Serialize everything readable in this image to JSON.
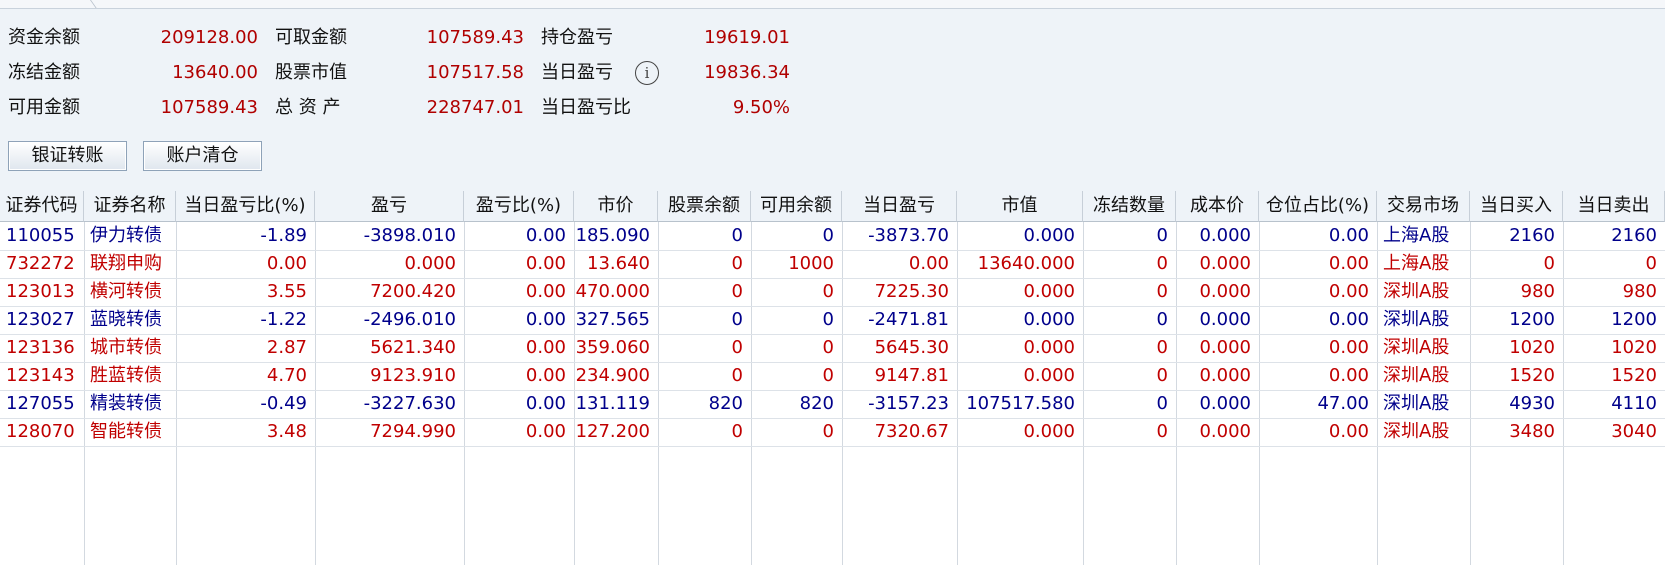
{
  "summary": [
    {
      "label": "资金余额",
      "value": "209128.00"
    },
    {
      "label": "冻结金额",
      "value": "13640.00"
    },
    {
      "label": "可用金额",
      "value": "107589.43"
    },
    {
      "label": "可取金额",
      "value": "107589.43"
    },
    {
      "label": "股票市值",
      "value": "107517.58"
    },
    {
      "label": "总 资 产",
      "value": "228747.01"
    },
    {
      "label": "持仓盈亏",
      "value": "19619.01"
    },
    {
      "label": "当日盈亏",
      "value": "19836.34"
    },
    {
      "label": "当日盈亏比",
      "value": "9.50%"
    }
  ],
  "info_icon": "i",
  "buttons": {
    "transfer": "银证转账",
    "clear": "账户清仓"
  },
  "columns": [
    "证券代码",
    "证券名称",
    "当日盈亏比(%)",
    "盈亏",
    "盈亏比(%)",
    "市价",
    "股票余额",
    "可用余额",
    "当日盈亏",
    "市值",
    "冻结数量",
    "成本价",
    "仓位占比(%)",
    "交易市场",
    "当日买入",
    "当日卖出"
  ],
  "rows": [
    {
      "color": "blue",
      "cells": [
        "110055",
        "伊力转债",
        "-1.89",
        "-3898.010",
        "0.00",
        "185.090",
        "0",
        "0",
        "-3873.70",
        "0.000",
        "0",
        "0.000",
        "0.00",
        "上海A股",
        "2160",
        "2160"
      ]
    },
    {
      "color": "red",
      "cells": [
        "732272",
        "联翔申购",
        "0.00",
        "0.000",
        "0.00",
        "13.640",
        "0",
        "1000",
        "0.00",
        "13640.000",
        "0",
        "0.000",
        "0.00",
        "上海A股",
        "0",
        "0"
      ]
    },
    {
      "color": "red",
      "cells": [
        "123013",
        "横河转债",
        "3.55",
        "7200.420",
        "0.00",
        "470.000",
        "0",
        "0",
        "7225.30",
        "0.000",
        "0",
        "0.000",
        "0.00",
        "深圳A股",
        "980",
        "980"
      ]
    },
    {
      "color": "blue",
      "cells": [
        "123027",
        "蓝晓转债",
        "-1.22",
        "-2496.010",
        "0.00",
        "327.565",
        "0",
        "0",
        "-2471.81",
        "0.000",
        "0",
        "0.000",
        "0.00",
        "深圳A股",
        "1200",
        "1200"
      ]
    },
    {
      "color": "red",
      "cells": [
        "123136",
        "城市转债",
        "2.87",
        "5621.340",
        "0.00",
        "359.060",
        "0",
        "0",
        "5645.30",
        "0.000",
        "0",
        "0.000",
        "0.00",
        "深圳A股",
        "1020",
        "1020"
      ]
    },
    {
      "color": "red",
      "cells": [
        "123143",
        "胜蓝转债",
        "4.70",
        "9123.910",
        "0.00",
        "234.900",
        "0",
        "0",
        "9147.81",
        "0.000",
        "0",
        "0.000",
        "0.00",
        "深圳A股",
        "1520",
        "1520"
      ]
    },
    {
      "color": "blue",
      "cells": [
        "127055",
        "精装转债",
        "-0.49",
        "-3227.630",
        "0.00",
        "131.119",
        "820",
        "820",
        "-3157.23",
        "107517.580",
        "0",
        "0.000",
        "47.00",
        "深圳A股",
        "4930",
        "4110"
      ]
    },
    {
      "color": "red",
      "cells": [
        "128070",
        "智能转债",
        "3.48",
        "7294.990",
        "0.00",
        "127.200",
        "0",
        "0",
        "7320.67",
        "0.000",
        "0",
        "0.000",
        "0.00",
        "深圳A股",
        "3480",
        "3040"
      ]
    }
  ]
}
